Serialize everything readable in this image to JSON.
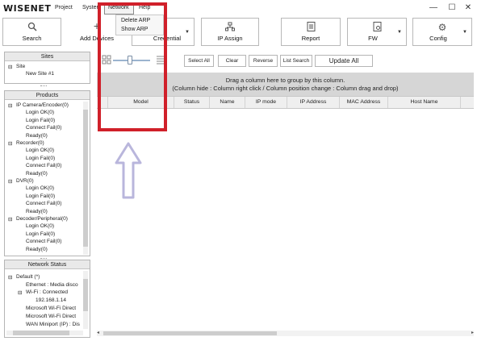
{
  "app": {
    "logo": "WISENET"
  },
  "menu": {
    "project": "Project",
    "system": "Syster",
    "network": "Network",
    "help": "Help"
  },
  "window_controls": {
    "minimize": "—",
    "maximize": "☐",
    "close": "✕"
  },
  "network_menu": {
    "items": [
      "Delete ARP",
      "Show ARP"
    ]
  },
  "toolbar": {
    "search": "Search",
    "add_devices": "Add Devices",
    "credential": "Credential",
    "ip_assign": "IP Assign",
    "report": "Report",
    "fw": "FW",
    "config": "Config"
  },
  "sites_panel": {
    "header": "Sites",
    "root": "Site",
    "child": "New Site #1"
  },
  "products_panel": {
    "header": "Products",
    "groups": [
      {
        "label": "IP Camera/Encoder(0)",
        "children": [
          "Login OK(0)",
          "Login Fail(0)",
          "Connect Fail(0)",
          "Ready(0)"
        ]
      },
      {
        "label": "Recorder(0)",
        "children": [
          "Login OK(0)",
          "Login Fail(0)",
          "Connect Fail(0)",
          "Ready(0)"
        ]
      },
      {
        "label": "DVR(0)",
        "children": [
          "Login OK(0)",
          "Login Fail(0)",
          "Connect Fail(0)",
          "Ready(0)"
        ]
      },
      {
        "label": "Decoder/Peripheral(0)",
        "children": [
          "Login OK(0)",
          "Login Fail(0)",
          "Connect Fail(0)",
          "Ready(0)"
        ]
      }
    ]
  },
  "network_status_panel": {
    "header": "Network Status",
    "root": "Default (*)",
    "items": [
      "Ethernet : Media disco",
      "Wi-Fi : Connected",
      "192.168.1.14",
      "Microsoft Wi-Fi Direct",
      "Microsoft Wi-Fi Direct",
      "WAN Miniport (IP) : Dis"
    ]
  },
  "grid_toolbar": {
    "select_all": "Select All",
    "clear": "Clear",
    "reverse": "Reverse",
    "list_search": "List Search",
    "update_all": "Update All"
  },
  "grid": {
    "group_hint_line1": "Drag a column here to group by this column.",
    "group_hint_line2": "(Column hide : Column right click / Column position change : Column drag and drop)",
    "columns": [
      "Model",
      "Status",
      "Name",
      "IP mode",
      "IP Address",
      "MAC Address",
      "Host Name"
    ]
  },
  "colors": {
    "highlight": "#d0202a",
    "arrow": "#b9b6dc",
    "group_area": "#d6d6d6"
  }
}
